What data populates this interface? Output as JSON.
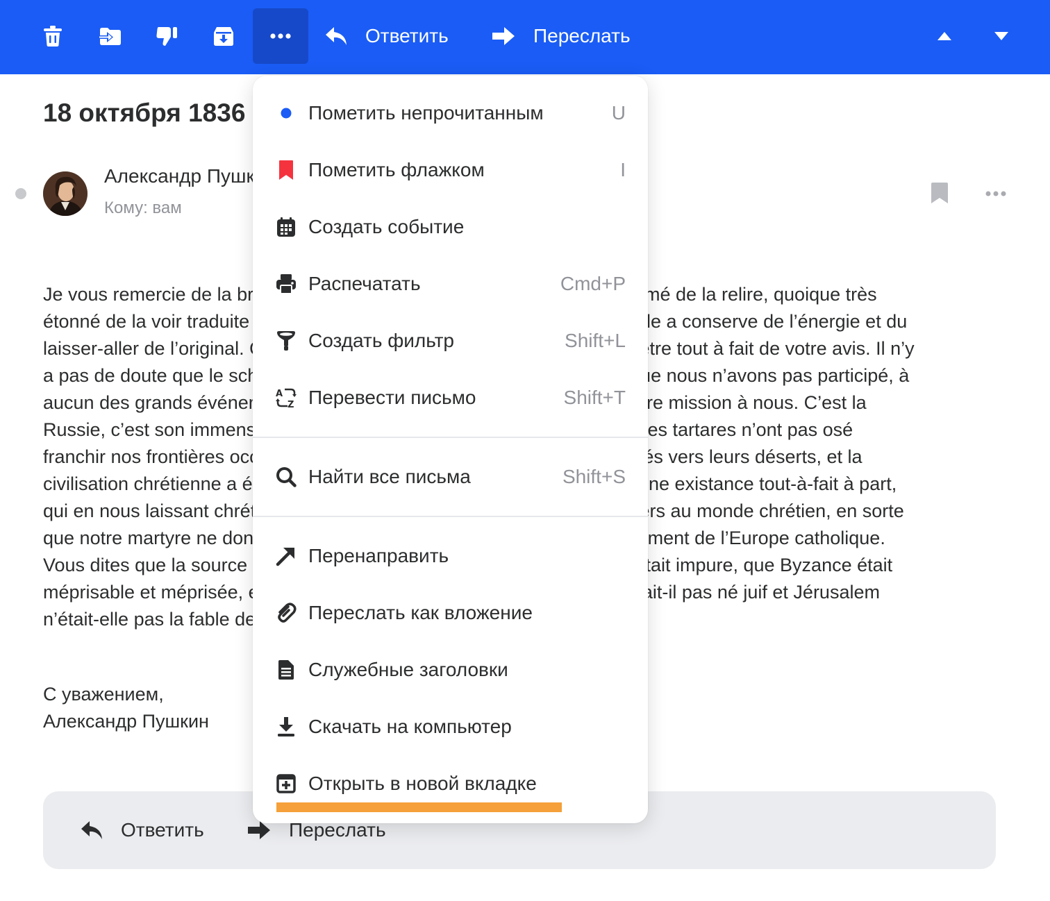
{
  "toolbar": {
    "background": "#1a5cf5",
    "icons": [
      "trash-icon",
      "move-to-folder-icon",
      "spam-icon",
      "archive-icon",
      "more-icon"
    ],
    "reply_label": "Ответить",
    "forward_label": "Переслать",
    "nav_icons": [
      "prev-arrow-icon",
      "next-arrow-icon"
    ]
  },
  "message": {
    "subject": "18 октября 1836",
    "sender_name": "Александр Пушкин",
    "to_label": "Кому: вам",
    "body_lines": [
      "Je vous remercie de la brochure que vous m’avez envoyée. J’ai été charmé de la relire, quoique très",
      "étonné de la voir traduite et imprimée. Je suis content de la traduction: elle a conserve de l’énergie et du",
      "laisser-aller de l’original. Quant aux idées, vous savez que je suis loin d’être tout à fait de votre avis. Il n’y",
      "a pas de doute que le schisme nous a séparés du reste de l’Europe et que nous n’avons pas participé, à",
      "aucun des grands événements qui l’ont remuée, mais nous avons eu notre mission à nous. C’est la",
      "Russie, c’est son immense étendue qui a absorbé la conquête Mogole. Les tartares n’ont pas osé",
      "franchir nos frontières occidentales et nous laisser à dos. Ils se sont retirés vers leurs déserts, et la",
      "civilisation chrétienne a été sauvée. Pour cette fin, nous avons dû avoir une existance tout-à-fait à part,",
      "qui en nous laissant chrétiens, nous laissait cependant tout-à-fait étrangers au monde chrétien, en sorte",
      "que notre martyre ne donnait aucune distraction au énergique développement de l’Europe catholique.",
      "Vous dites que la source où nous sommes allés puiser le christianisme était impure, que Byzance était",
      "méprisable et méprisée, etc. — hé, mon ami! Jésus Christ lui-même n’était-il pas né juif et Jérusalem",
      "n’était-elle pas la fable des nations?"
    ],
    "signature": [
      "С уважением,",
      "Александр Пушкин"
    ]
  },
  "reply_bar": {
    "reply_label": "Ответить",
    "forward_label": "Переслать"
  },
  "menu": {
    "items": [
      {
        "label": "Пометить непрочитанным",
        "shortcut": "U",
        "icon": "unread-dot-icon"
      },
      {
        "label": "Пометить флажком",
        "shortcut": "I",
        "icon": "flag-icon"
      },
      {
        "label": "Создать событие",
        "shortcut": "",
        "icon": "calendar-icon"
      },
      {
        "label": "Распечатать",
        "shortcut": "Cmd+P",
        "icon": "printer-icon"
      },
      {
        "label": "Создать фильтр",
        "shortcut": "Shift+L",
        "icon": "filter-icon"
      },
      {
        "label": "Перевести письмо",
        "shortcut": "Shift+T",
        "icon": "translate-icon"
      },
      {
        "label": "Найти все письма",
        "shortcut": "Shift+S",
        "icon": "search-icon"
      },
      {
        "label": "Перенаправить",
        "shortcut": "",
        "icon": "redirect-arrow-icon"
      },
      {
        "label": "Переслать как вложение",
        "shortcut": "",
        "icon": "paperclip-icon"
      },
      {
        "label": "Служебные заголовки",
        "shortcut": "",
        "icon": "document-icon"
      },
      {
        "label": "Скачать на компьютер",
        "shortcut": "",
        "icon": "download-icon"
      },
      {
        "label": "Открыть в новой вкладке",
        "shortcut": "",
        "icon": "new-tab-icon"
      }
    ],
    "accent_dot": "#1a5cf5",
    "flag_color": "#f5333f",
    "highlight_color": "#f5a03a"
  }
}
